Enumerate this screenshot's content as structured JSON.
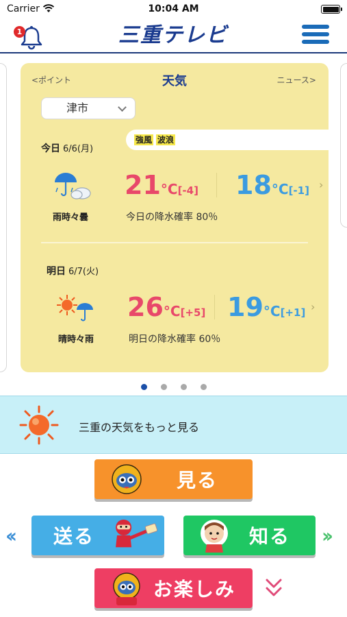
{
  "status_bar": {
    "carrier": "Carrier",
    "time": "10:04 AM"
  },
  "header": {
    "notification_count": "1",
    "logo": "三重テレビ"
  },
  "weather_card": {
    "prev_label": "<ポイント",
    "title": "天気",
    "next_label": "ニュース>",
    "city": "津市",
    "warnings": [
      "強風",
      "波浪"
    ],
    "today": {
      "label": "今日",
      "date": "6/6(月)",
      "weather": "雨時々曇",
      "high": "21",
      "high_diff": "[-4]",
      "low": "18",
      "low_diff": "[-1]",
      "unit": "°C",
      "precip": "今日の降水確率 80％"
    },
    "tomorrow": {
      "label": "明日",
      "date": "6/7(火)",
      "weather": "晴時々雨",
      "high": "26",
      "high_diff": "[+5]",
      "low": "19",
      "low_diff": "[+1]",
      "unit": "°C",
      "precip": "明日の降水確率 60％"
    }
  },
  "pager": {
    "count": 4,
    "active": 0
  },
  "banner": {
    "text": "三重の天気をもっと見る"
  },
  "menu": {
    "miru": "見る",
    "okuru": "送る",
    "shiru": "知る",
    "tanoshimi": "お楽しみ"
  },
  "colors": {
    "card_bg": "#f5e9a0",
    "high_temp": "#e8486a",
    "low_temp": "#3b9be0",
    "brand_blue": "#1a3b8f",
    "banner_bg": "#c8f0f8",
    "btn_orange": "#f7922b",
    "btn_blue": "#45aee6",
    "btn_green": "#1fc763",
    "btn_pink": "#ee3e63"
  },
  "icons": [
    "wifi-icon",
    "battery-icon",
    "bell-icon",
    "menu-icon",
    "rain-cloud-icon",
    "sun-rain-icon",
    "sun-icon",
    "chevron-down-icon"
  ]
}
